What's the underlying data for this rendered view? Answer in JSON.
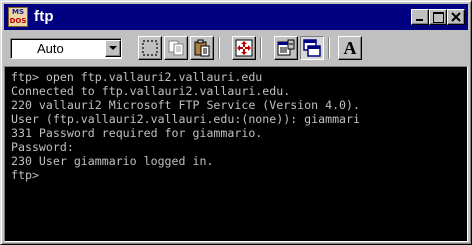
{
  "window": {
    "title": "ftp",
    "app_icon": {
      "name": "ms-dos-icon",
      "line1": "MS",
      "line2": "DOS"
    },
    "caption_buttons": [
      "minimize",
      "maximize",
      "close"
    ]
  },
  "toolbar": {
    "font_size_value": "Auto",
    "buttons": [
      {
        "name": "mark-icon",
        "pressed": false
      },
      {
        "name": "copy-icon",
        "pressed": false
      },
      {
        "name": "paste-icon",
        "pressed": false
      },
      {
        "name": "full-screen-icon",
        "pressed": false
      },
      {
        "name": "properties-icon",
        "pressed": false
      },
      {
        "name": "background-icon",
        "pressed": true
      },
      {
        "name": "font-icon",
        "pressed": false,
        "label": "A"
      }
    ]
  },
  "terminal": {
    "lines": [
      "ftp> open ftp.vallauri2.vallauri.edu",
      "Connected to ftp.vallauri2.vallauri.edu.",
      "220 vallauri2 Microsoft FTP Service (Version 4.0).",
      "User (ftp.vallauri2.vallauri.edu:(none)): giammari",
      "331 Password required for giammario.",
      "Password:",
      "230 User giammario logged in.",
      "ftp>"
    ]
  },
  "colors": {
    "title_bar": "#000080",
    "chrome": "#c0c0c0",
    "terminal_bg": "#000000",
    "terminal_text": "#c0c0c0"
  }
}
